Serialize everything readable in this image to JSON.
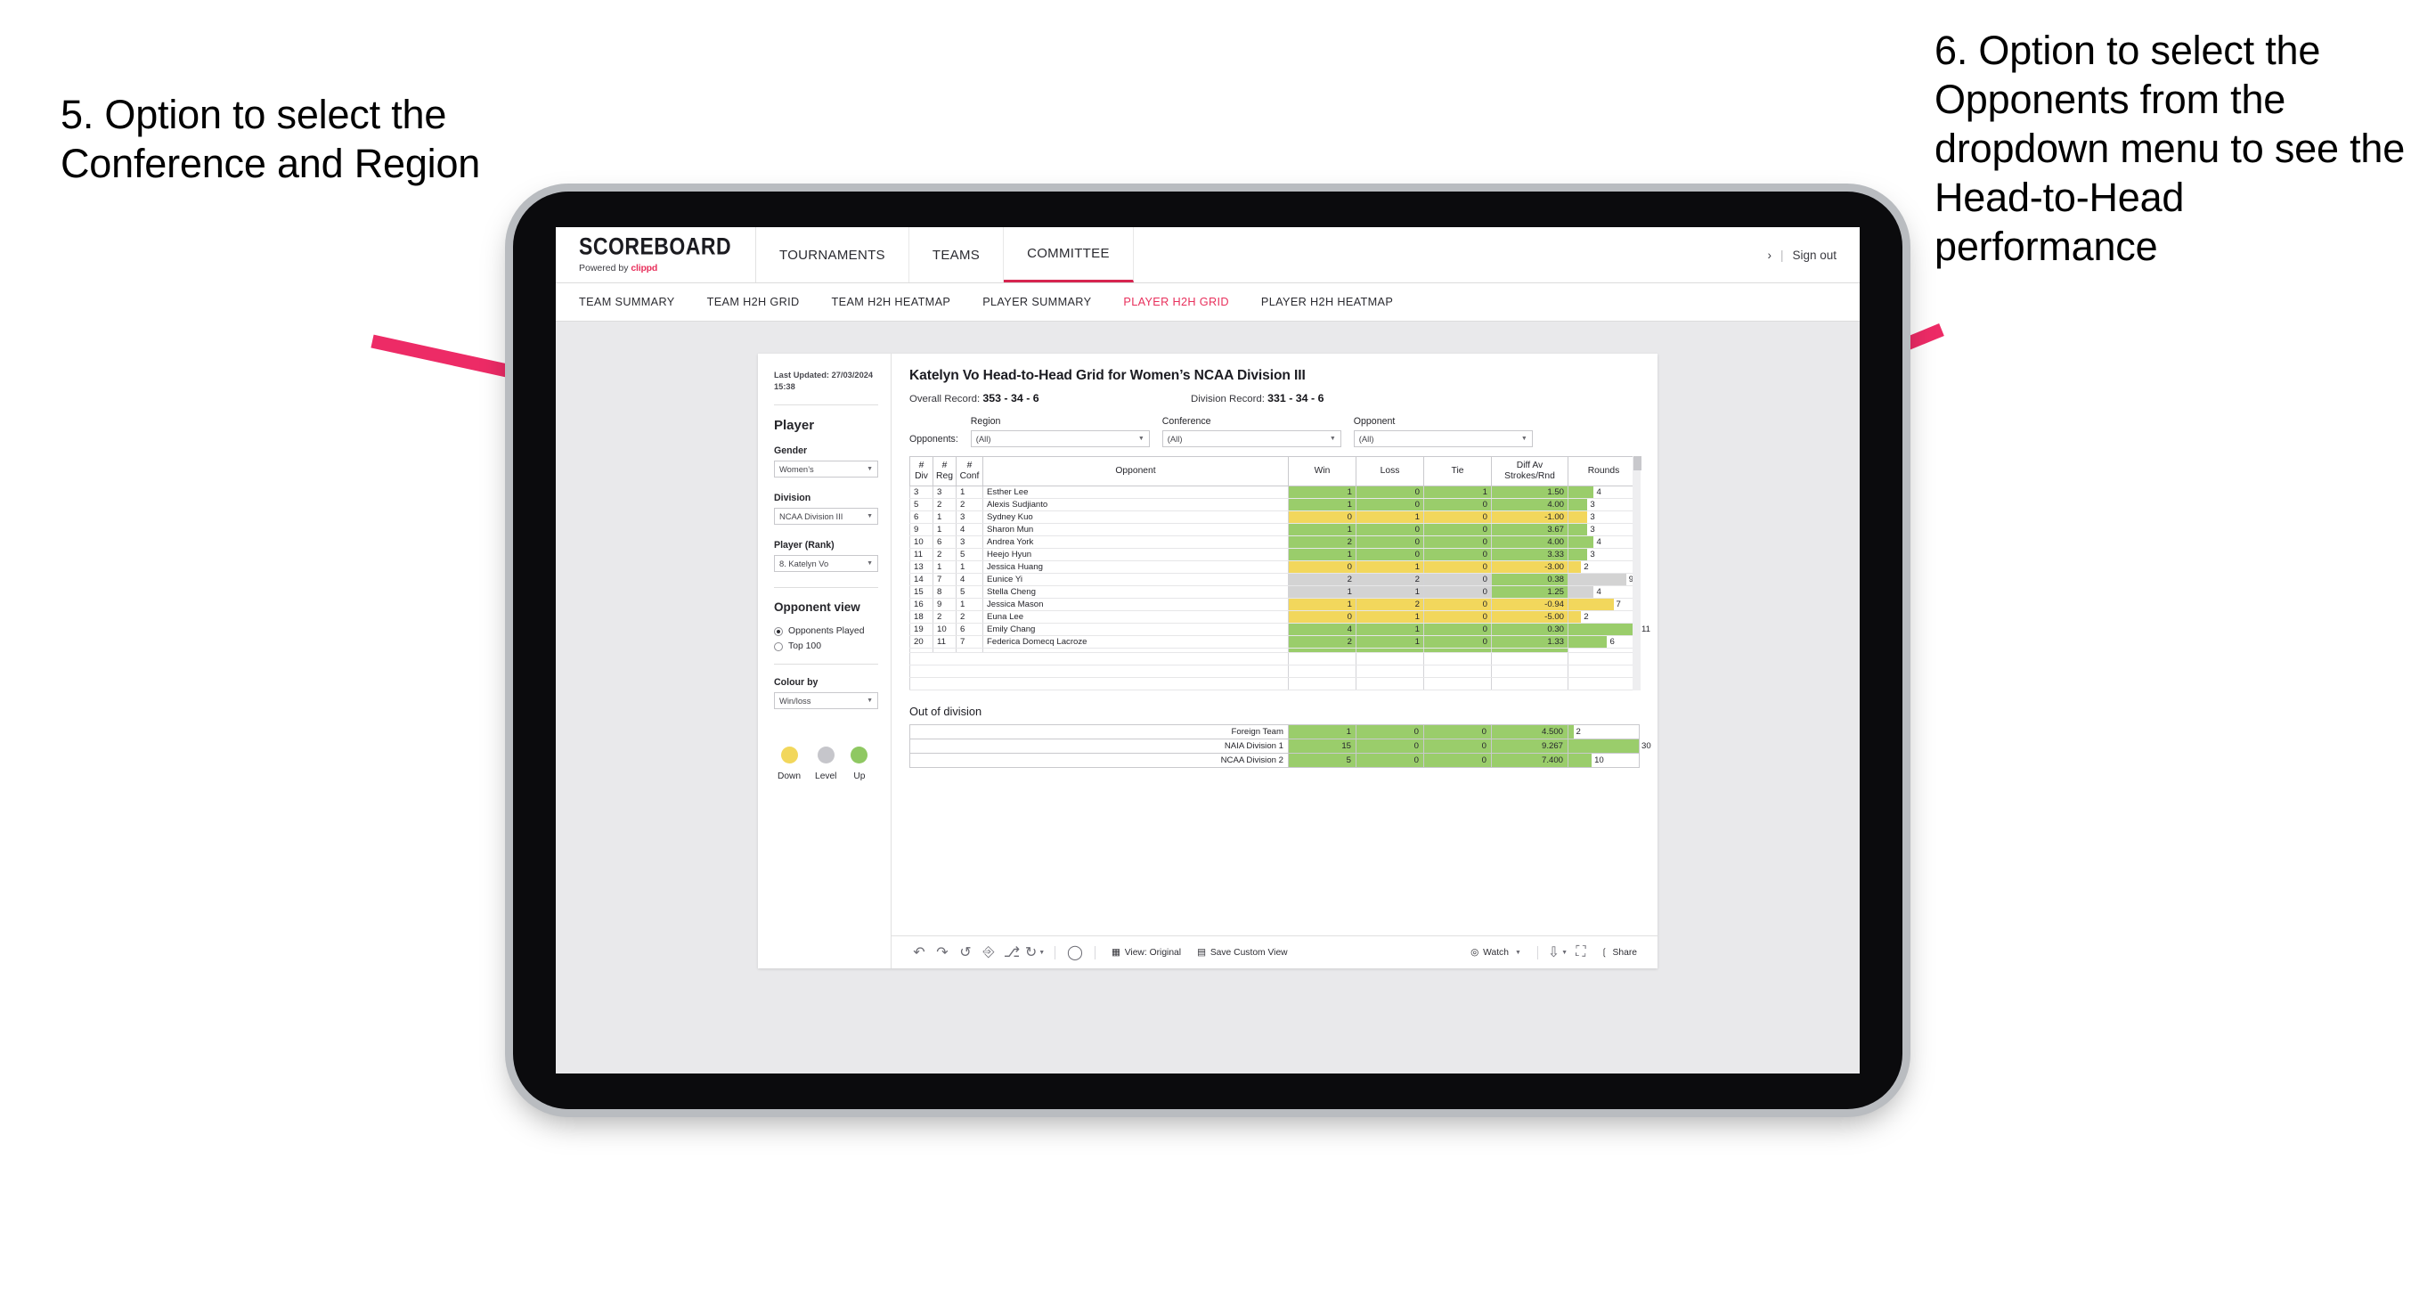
{
  "annotations": {
    "left": "5. Option to select the Conference and Region",
    "right": "6. Option to select the Opponents from the dropdown menu to see the Head-to-Head performance",
    "arrow_color": "#ED2B66"
  },
  "app": {
    "brand": {
      "name": "SCOREBOARD",
      "powered_prefix": "Powered by ",
      "powered_by": "clippd"
    },
    "topnav": [
      {
        "label": "TOURNAMENTS",
        "active": false
      },
      {
        "label": "TEAMS",
        "active": false
      },
      {
        "label": "COMMITTEE",
        "active": true
      }
    ],
    "top_right": {
      "chevron": "›",
      "separator": "|",
      "signout": "Sign out"
    },
    "subnav": [
      {
        "label": "TEAM SUMMARY",
        "active": false
      },
      {
        "label": "TEAM H2H GRID",
        "active": false
      },
      {
        "label": "TEAM H2H HEATMAP",
        "active": false
      },
      {
        "label": "PLAYER SUMMARY",
        "active": false
      },
      {
        "label": "PLAYER H2H GRID",
        "active": true
      },
      {
        "label": "PLAYER H2H HEATMAP",
        "active": false
      }
    ]
  },
  "sidebar": {
    "last_updated": "Last Updated: 27/03/2024 15:38",
    "player_heading": "Player",
    "fields": [
      {
        "label": "Gender",
        "value": "Women’s"
      },
      {
        "label": "Division",
        "value": "NCAA Division III"
      },
      {
        "label": "Player (Rank)",
        "value": "8. Katelyn Vo"
      }
    ],
    "opponent_view": {
      "heading": "Opponent view",
      "options": [
        {
          "label": "Opponents Played",
          "selected": true
        },
        {
          "label": "Top 100",
          "selected": false
        }
      ]
    },
    "colour_by": {
      "label": "Colour by",
      "value": "Win/loss"
    },
    "legend": [
      {
        "label": "Down",
        "color": "#F2D75C"
      },
      {
        "label": "Level",
        "color": "#C6C6CB"
      },
      {
        "label": "Up",
        "color": "#8FC862"
      }
    ]
  },
  "main": {
    "title": "Katelyn Vo Head-to-Head Grid for Women’s NCAA Division III",
    "overall_record_label": "Overall Record:",
    "overall_record_value": "353 -  34 - 6",
    "division_record_label": "Division Record:",
    "division_record_value": "331 -  34 - 6",
    "opponents_label": "Opponents:",
    "filters": [
      {
        "label": "Region",
        "value": "(All)"
      },
      {
        "label": "Conference",
        "value": "(All)"
      },
      {
        "label": "Opponent",
        "value": "(All)"
      }
    ],
    "out_of_division_heading": "Out of division"
  },
  "chart_data": {
    "type": "table",
    "title": "Katelyn Vo Head-to-Head Grid for Women’s NCAA Division III",
    "columns": [
      "# Div",
      "# Reg",
      "# Conf",
      "Opponent",
      "Win",
      "Loss",
      "Tie",
      "Diff Av Strokes/Rnd",
      "Rounds"
    ],
    "column_headers_multiline": [
      {
        "l1": "#",
        "l2": "Div"
      },
      {
        "l1": "#",
        "l2": "Reg"
      },
      {
        "l1": "#",
        "l2": "Conf"
      },
      {
        "l1": "Opponent",
        "l2": ""
      },
      {
        "l1": "Win",
        "l2": ""
      },
      {
        "l1": "Loss",
        "l2": ""
      },
      {
        "l1": "Tie",
        "l2": ""
      },
      {
        "l1": "Diff Av",
        "l2": "Strokes/Rnd"
      },
      {
        "l1": "Rounds",
        "l2": ""
      }
    ],
    "rows_max_rounds": 11,
    "rows": [
      {
        "div": "3",
        "reg": "3",
        "conf": "1",
        "opponent": "Esther Lee",
        "win": "1",
        "loss": "0",
        "tie": "1",
        "diff": "1.50",
        "rounds": "4",
        "status": "up"
      },
      {
        "div": "5",
        "reg": "2",
        "conf": "2",
        "opponent": "Alexis Sudjianto",
        "win": "1",
        "loss": "0",
        "tie": "0",
        "diff": "4.00",
        "rounds": "3",
        "status": "up"
      },
      {
        "div": "6",
        "reg": "1",
        "conf": "3",
        "opponent": "Sydney Kuo",
        "win": "0",
        "loss": "1",
        "tie": "0",
        "diff": "-1.00",
        "rounds": "3",
        "status": "down"
      },
      {
        "div": "9",
        "reg": "1",
        "conf": "4",
        "opponent": "Sharon Mun",
        "win": "1",
        "loss": "0",
        "tie": "0",
        "diff": "3.67",
        "rounds": "3",
        "status": "up"
      },
      {
        "div": "10",
        "reg": "6",
        "conf": "3",
        "opponent": "Andrea York",
        "win": "2",
        "loss": "0",
        "tie": "0",
        "diff": "4.00",
        "rounds": "4",
        "status": "up"
      },
      {
        "div": "11",
        "reg": "2",
        "conf": "5",
        "opponent": "Heejo Hyun",
        "win": "1",
        "loss": "0",
        "tie": "0",
        "diff": "3.33",
        "rounds": "3",
        "status": "up"
      },
      {
        "div": "13",
        "reg": "1",
        "conf": "1",
        "opponent": "Jessica Huang",
        "win": "0",
        "loss": "1",
        "tie": "0",
        "diff": "-3.00",
        "rounds": "2",
        "status": "down"
      },
      {
        "div": "14",
        "reg": "7",
        "conf": "4",
        "opponent": "Eunice Yi",
        "win": "2",
        "loss": "2",
        "tie": "0",
        "diff": "0.38",
        "rounds": "9",
        "status": "level",
        "diff_status": "up"
      },
      {
        "div": "15",
        "reg": "8",
        "conf": "5",
        "opponent": "Stella Cheng",
        "win": "1",
        "loss": "1",
        "tie": "0",
        "diff": "1.25",
        "rounds": "4",
        "status": "level",
        "diff_status": "up"
      },
      {
        "div": "16",
        "reg": "9",
        "conf": "1",
        "opponent": "Jessica Mason",
        "win": "1",
        "loss": "2",
        "tie": "0",
        "diff": "-0.94",
        "rounds": "7",
        "status": "down"
      },
      {
        "div": "18",
        "reg": "2",
        "conf": "2",
        "opponent": "Euna Lee",
        "win": "0",
        "loss": "1",
        "tie": "0",
        "diff": "-5.00",
        "rounds": "2",
        "status": "down"
      },
      {
        "div": "19",
        "reg": "10",
        "conf": "6",
        "opponent": "Emily Chang",
        "win": "4",
        "loss": "1",
        "tie": "0",
        "diff": "0.30",
        "rounds": "11",
        "status": "up"
      },
      {
        "div": "20",
        "reg": "11",
        "conf": "7",
        "opponent": "Federica Domecq Lacroze",
        "win": "2",
        "loss": "1",
        "tie": "0",
        "diff": "1.33",
        "rounds": "6",
        "status": "up"
      }
    ],
    "out_of_division": {
      "heading": "Out of division",
      "max_rounds": 30,
      "rows": [
        {
          "name": "Foreign Team",
          "win": "1",
          "loss": "0",
          "tie": "0",
          "diff": "4.500",
          "rounds": "2",
          "status": "up"
        },
        {
          "name": "NAIA Division 1",
          "win": "15",
          "loss": "0",
          "tie": "0",
          "diff": "9.267",
          "rounds": "30",
          "status": "up"
        },
        {
          "name": "NCAA Division 2",
          "win": "5",
          "loss": "0",
          "tie": "0",
          "diff": "7.400",
          "rounds": "10",
          "status": "up"
        }
      ]
    },
    "colors": {
      "up": "#9ACD6B",
      "down": "#F2D75C",
      "level": "#D3D3D3",
      "accent": "#E8305C"
    }
  },
  "toolbar": {
    "icons": [
      "undo-icon",
      "redo-icon",
      "revert-icon",
      "refresh-data-icon",
      "pause-updates-icon",
      "presentation-icon"
    ],
    "dashboard_icon": "dashboard-icon",
    "view_label": "View: Original",
    "save_icon": "save-view-icon",
    "save_label": "Save Custom View",
    "watch_icon": "watch-icon",
    "watch_label": "Watch",
    "download_icon": "download-icon",
    "fullscreen_icon": "fullscreen-icon",
    "share_icon": "share-icon",
    "share_label": "Share"
  }
}
